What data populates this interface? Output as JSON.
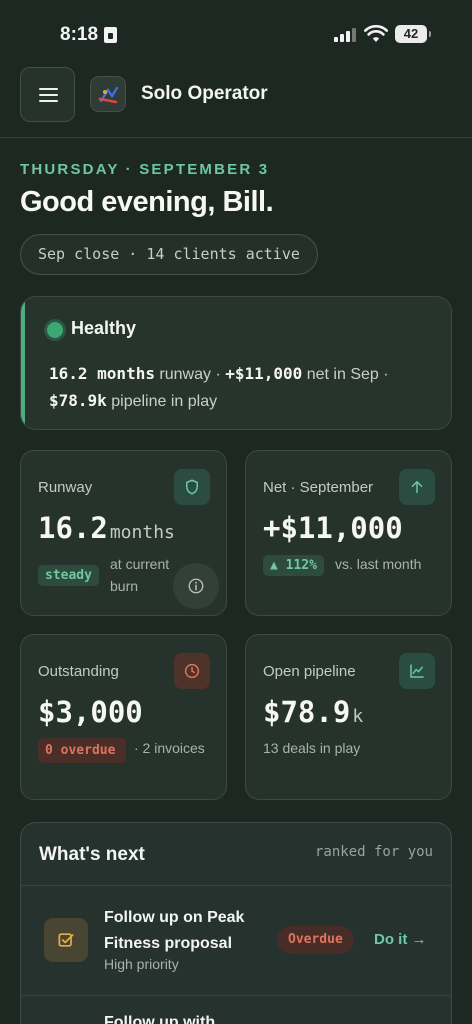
{
  "status_bar": {
    "time": "8:18",
    "battery": "42"
  },
  "header": {
    "title": "Solo Operator"
  },
  "greeting": {
    "date": "THURSDAY · SEPTEMBER 3",
    "text": "Good evening, Bill.",
    "context": "Sep close · 14 clients active"
  },
  "health": {
    "label": "Healthy",
    "runway_value": "16.2 months",
    "runway_suffix": " runway · ",
    "net_value": "+$11,000",
    "net_suffix": " net in Sep · ",
    "pipeline_value": "$78.9k",
    "pipeline_suffix": " pipeline in play",
    "status_color": "#3aa872"
  },
  "cards": {
    "runway": {
      "label": "Runway",
      "value": "16.2",
      "unit": "months",
      "badge": "steady",
      "sub": "at current burn",
      "icon": "shield-icon"
    },
    "net": {
      "label": "Net · September",
      "value": "+$11,000",
      "badge": "▲ 112%",
      "sub": "vs. last month",
      "icon": "arrow-up-icon"
    },
    "outstanding": {
      "label": "Outstanding",
      "value": "$3,000",
      "badge": "0 overdue",
      "sub": "· 2 invoices",
      "icon": "clock-icon"
    },
    "pipeline": {
      "label": "Open pipeline",
      "value": "$78.9",
      "unit": "k",
      "sub": "13 deals in play",
      "icon": "trend-chart-icon"
    }
  },
  "next": {
    "title": "What's next",
    "hint": "ranked for you",
    "tasks": [
      {
        "title": "Follow up on Peak Fitness proposal",
        "priority": "High priority",
        "status": "Overdue",
        "action": "Do it →",
        "icon": "checkbox-edit-icon"
      },
      {
        "title": "Follow up with"
      }
    ]
  },
  "colors": {
    "accent": "#6ec6a6",
    "background": "#1d2823",
    "card": "#26332d",
    "danger": "#e0735c"
  }
}
